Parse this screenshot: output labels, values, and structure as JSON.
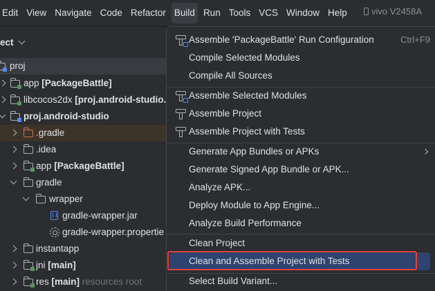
{
  "menubar": {
    "items": [
      "Edit",
      "View",
      "Navigate",
      "Code",
      "Refactor",
      "Build",
      "Run",
      "Tools",
      "VCS",
      "Window",
      "Help"
    ],
    "device": "vivo V2458A"
  },
  "project_panel": {
    "title": "ect",
    "rows": [
      {
        "name": "proj",
        "bold": "",
        "extra": ""
      },
      {
        "name": "app ",
        "bold": "[PackageBattle]",
        "extra": ""
      },
      {
        "name": "libcocos2dx ",
        "bold": "[proj.android-studio.l",
        "extra": ""
      },
      {
        "name": "",
        "bold": "proj.android-studio",
        "extra": ""
      },
      {
        "name": ".gradle",
        "bold": "",
        "extra": ""
      },
      {
        "name": ".idea",
        "bold": "",
        "extra": ""
      },
      {
        "name": "app ",
        "bold": "[PackageBattle]",
        "extra": ""
      },
      {
        "name": "gradle",
        "bold": "",
        "extra": ""
      },
      {
        "name": "wrapper",
        "bold": "",
        "extra": ""
      },
      {
        "name": "gradle-wrapper.jar",
        "bold": "",
        "extra": ""
      },
      {
        "name": "gradle-wrapper.propertie",
        "bold": "",
        "extra": ""
      },
      {
        "name": "instantapp",
        "bold": "",
        "extra": ""
      },
      {
        "name": "jni ",
        "bold": "[main]",
        "extra": ""
      },
      {
        "name": "res ",
        "bold": "[main]",
        "extra": "resources root"
      }
    ]
  },
  "build_menu": {
    "items": [
      {
        "label": "Assemble 'PackageBattle' Run Configuration",
        "shortcut": "Ctrl+F9"
      },
      {
        "label": "Compile Selected Modules",
        "shortcut": ""
      },
      {
        "label": "Compile All Sources",
        "shortcut": ""
      },
      {
        "label": "Assemble Selected Modules",
        "shortcut": ""
      },
      {
        "label": "Assemble Project",
        "shortcut": ""
      },
      {
        "label": "Assemble Project with Tests",
        "shortcut": ""
      },
      {
        "label": "Generate App Bundles or APKs",
        "shortcut": ""
      },
      {
        "label": "Generate Signed App Bundle or APK...",
        "shortcut": ""
      },
      {
        "label": "Analyze APK...",
        "shortcut": ""
      },
      {
        "label": "Deploy Module to App Engine...",
        "shortcut": ""
      },
      {
        "label": "Analyze Build Performance",
        "shortcut": ""
      },
      {
        "label": "Clean Project",
        "shortcut": ""
      },
      {
        "label": "Clean and Assemble Project with Tests",
        "shortcut": ""
      },
      {
        "label": "Select Build Variant...",
        "shortcut": ""
      }
    ]
  },
  "colors": {
    "background": "#2b2d30",
    "selection": "#2e436e",
    "highlight_box": "#e0433b"
  }
}
